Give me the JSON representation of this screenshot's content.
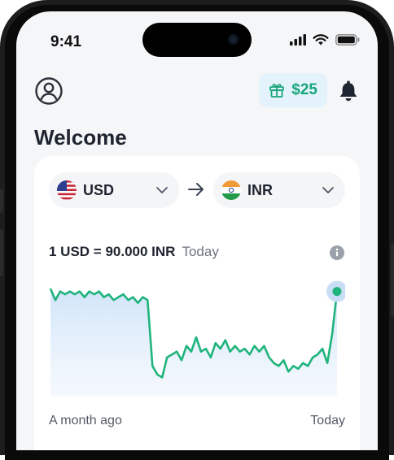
{
  "status_bar": {
    "time": "9:41"
  },
  "header": {
    "reward_amount": "$25"
  },
  "page": {
    "title": "Welcome"
  },
  "converter": {
    "from_currency": "USD",
    "to_currency": "INR",
    "rate_text": "1 USD = 90.000 INR",
    "rate_time": "Today"
  },
  "colors": {
    "accent": "#17a57a",
    "badge_bg": "#e4f3fb",
    "line": "#1fb47c"
  },
  "chart_data": {
    "type": "line",
    "title": "",
    "xlabel": "",
    "ylabel": "",
    "x_range_labels": [
      "A month ago",
      "Today"
    ],
    "grid": false,
    "series": [
      {
        "values": [
          90.0,
          89.96,
          89.99,
          89.98,
          89.99,
          89.98,
          89.99,
          89.97,
          89.99,
          89.98,
          89.99,
          89.97,
          89.98,
          89.96,
          89.97,
          89.98,
          89.96,
          89.97,
          89.95,
          89.97,
          89.96,
          89.73,
          89.7,
          89.69,
          89.76,
          89.77,
          89.78,
          89.75,
          89.8,
          89.78,
          89.83,
          89.78,
          89.79,
          89.76,
          89.81,
          89.79,
          89.82,
          89.78,
          89.8,
          89.78,
          89.79,
          89.77,
          89.8,
          89.78,
          89.8,
          89.76,
          89.74,
          89.73,
          89.75,
          89.71,
          89.73,
          89.72,
          89.74,
          89.73,
          89.76,
          89.77,
          89.79,
          89.74,
          89.84,
          89.99
        ]
      }
    ]
  },
  "chart_labels": {
    "x_start": "A month ago",
    "x_end": "Today"
  }
}
